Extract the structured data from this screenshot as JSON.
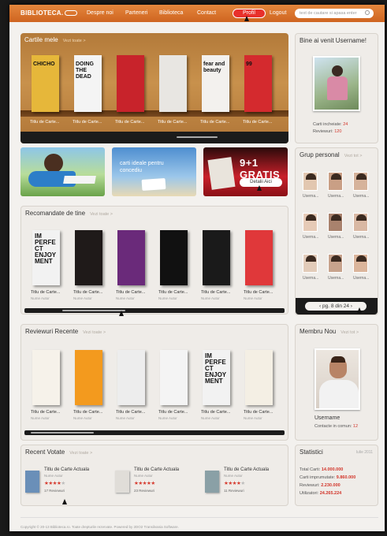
{
  "nav": {
    "logo": "BIBLIOTECA.",
    "items": [
      "Despre noi",
      "Parteneri",
      "Biblioteca",
      "Contact"
    ],
    "active": "Profil",
    "logout": "Logout",
    "search_placeholder": "text de cautare si apasa enter"
  },
  "colors": {
    "accent": "#d2352a",
    "nav": "#d8742f",
    "wood": "#b9803f"
  },
  "favorites": {
    "title": "Cartile mele",
    "view_all": "Vezi toate >",
    "books": [
      {
        "caption": "Titlu de Carte...",
        "cover_text": "CHICHO",
        "bg": "#e6b73a"
      },
      {
        "caption": "Titlu de Carte...",
        "cover_text": "DOING THE DEAD",
        "bg": "#f4f4f4"
      },
      {
        "caption": "Titlu de Carte...",
        "cover_text": "",
        "bg": "#c8232b"
      },
      {
        "caption": "Titlu de Carte...",
        "cover_text": "",
        "bg": "#e8e6e2"
      },
      {
        "caption": "Titlu de Carte...",
        "cover_text": "fear and beauty",
        "bg": "#f3f1ee"
      },
      {
        "caption": "Titlu de Carte...",
        "cover_text": "99",
        "bg": "#d42a2e"
      }
    ]
  },
  "welcome": {
    "title": "Bine ai venit Username!",
    "books_read_label": "Carti incheiate:",
    "books_read": "24",
    "reviews_label": "Reviewuri:",
    "reviews": "120"
  },
  "promos": {
    "vacation_text": "carti ideale pentru concediu",
    "offer_title": "9+1 GRATIS",
    "offer_button": "Detalii Aici"
  },
  "group": {
    "title": "Grup personal",
    "view_all": "Vezi tot >",
    "users": [
      "Userna...",
      "Userna...",
      "Userna...",
      "Userna...",
      "Userna...",
      "Userna...",
      "Userna...",
      "Userna...",
      "Userna..."
    ],
    "pager": "pg. 8 din 24"
  },
  "recommended": {
    "title": "Recomandate de tine",
    "view_all": "Vezi toate >",
    "books": [
      {
        "caption": "Titlu de Carte...",
        "author": "Nume Autor",
        "cover_text": "IM PERFECT ENJOY MENT",
        "bg": "#f2f2f2"
      },
      {
        "caption": "Titlu de Carte...",
        "author": "Nume Autor",
        "cover_text": "",
        "bg": "#1f1a19"
      },
      {
        "caption": "Titlu de Carte...",
        "author": "Nume Autor",
        "cover_text": "",
        "bg": "#6a2a7a"
      },
      {
        "caption": "Titlu de Carte...",
        "author": "Nume Autor",
        "cover_text": "",
        "bg": "#111111"
      },
      {
        "caption": "Titlu de Carte...",
        "author": "Nume Autor",
        "cover_text": "",
        "bg": "#1a1a1a"
      },
      {
        "caption": "Titlu de Carte...",
        "author": "Nume Autor",
        "cover_text": "",
        "bg": "#e0383a"
      }
    ]
  },
  "reviews": {
    "title": "Reviewuri Recente",
    "view_all": "Vezi toate >",
    "books": [
      {
        "caption": "Titlu de Carte...",
        "author": "Nume Autor",
        "cover_text": "",
        "bg": "#f6f2ea"
      },
      {
        "caption": "Titlu de Carte...",
        "author": "Nume Autor",
        "cover_text": "",
        "bg": "#f39a1e"
      },
      {
        "caption": "Titlu de Carte...",
        "author": "Nume Autor",
        "cover_text": "",
        "bg": "#ededed"
      },
      {
        "caption": "Titlu de Carte...",
        "author": "Nume Autor",
        "cover_text": "",
        "bg": "#f4f4f4"
      },
      {
        "caption": "Titlu de Carte...",
        "author": "Nume Autor",
        "cover_text": "IM PERFECT ENJOY MENT",
        "bg": "#f2f2f2"
      },
      {
        "caption": "Titlu de Carte...",
        "author": "Nume Autor",
        "cover_text": "",
        "bg": "#f4efe4"
      }
    ]
  },
  "new_member": {
    "title": "Membru Nou",
    "view_all": "Vezi tot >",
    "username": "Username",
    "contacts_label": "Contacte in comun:",
    "contacts": "12"
  },
  "votes": {
    "title": "Recent Votate",
    "view_all": "Vezi toate >",
    "items": [
      {
        "title": "Titlu de Carte Actuala",
        "author": "Nume Autor",
        "rating": 4,
        "count": "17 Reviewuri"
      },
      {
        "title": "Titlu de Carte Actuala",
        "author": "Nume Autor",
        "rating": 5,
        "count": "23 Reviewuri"
      },
      {
        "title": "Titlu de Carte Actuala",
        "author": "Nume Autor",
        "rating": 4,
        "count": "11 Reviewuri"
      }
    ]
  },
  "stats": {
    "title": "Statistici",
    "date": "Iulie 2011",
    "rows": [
      {
        "label": "Total Carti:",
        "value": "14.000.000"
      },
      {
        "label": "Carti imprumutate:",
        "value": "9.860.000"
      },
      {
        "label": "Reviewuri:",
        "value": "2.230.000"
      },
      {
        "label": "Utilizatori:",
        "value": "24.265.224"
      }
    ]
  },
  "footer": "Copyright © 20-13 Biblioteca.ro. Toate drepturile rezervate.  Powered by 2DO2 Transilvania Software."
}
